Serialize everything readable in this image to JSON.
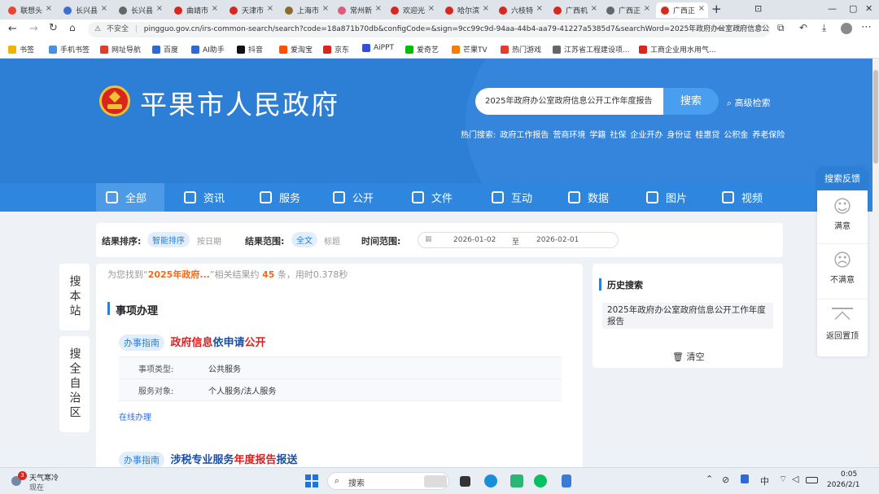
{
  "browser": {
    "tabs": [
      {
        "label": "联想头",
        "color": "#e8442e"
      },
      {
        "label": "长兴县",
        "color": "#3b6fd8"
      },
      {
        "label": "长兴县",
        "color": "#666"
      },
      {
        "label": "曲靖市",
        "color": "#d8281e"
      },
      {
        "label": "天津市",
        "color": "#d8281e"
      },
      {
        "label": "上海市",
        "color": "#8a6d2e"
      },
      {
        "label": "常州新",
        "color": "#e05a7a"
      },
      {
        "label": "欢迎光",
        "color": "#d8281e"
      },
      {
        "label": "哈尔滨",
        "color": "#d8281e"
      },
      {
        "label": "六枝特",
        "color": "#d8281e"
      },
      {
        "label": "广西机",
        "color": "#d8281e"
      },
      {
        "label": "广西正",
        "color": "#666"
      },
      {
        "label": "广西正",
        "color": "#d8281e"
      }
    ],
    "new_tab": "+",
    "insecure_label": "不安全",
    "url": "pingguo.gov.cn/irs-common-search/search?code=18a871b70db&configCode=&sign=9cc99c9d-94aa-44b4-aa79-41227a5385d7&searchWord=2025年政府办公室政府信息公...",
    "bookmarks": [
      {
        "label": "书签",
        "color": "#f0b400"
      },
      {
        "label": "手机书签",
        "color": "#4a90e2"
      },
      {
        "label": "网址导航",
        "color": "#e23c2c"
      },
      {
        "label": "百度",
        "color": "#2d6ad8"
      },
      {
        "label": "AI助手",
        "color": "#2d6ad8"
      },
      {
        "label": "抖音",
        "color": "#111"
      },
      {
        "label": "爱淘宝",
        "color": "#ff5000"
      },
      {
        "label": "京东",
        "color": "#d8281e"
      },
      {
        "label": "AiPPT",
        "color": "#3050e0"
      },
      {
        "label": "爱奇艺",
        "color": "#00be06"
      },
      {
        "label": "芒果TV",
        "color": "#ff7a00"
      },
      {
        "label": "热门游戏",
        "color": "#e23c2c"
      },
      {
        "label": "江苏省工程建设项...",
        "color": "#666"
      },
      {
        "label": "工商企业用水用气...",
        "color": "#d8281e"
      }
    ]
  },
  "site": {
    "title": "平果市人民政府",
    "search_value": "2025年政府办公室政府信息公开工作年度报告",
    "search_button": "搜索",
    "advanced": "高级检索",
    "hot_label": "热门搜索:",
    "hot": [
      "政府工作报告",
      "营商环境",
      "学籍",
      "社保",
      "企业开办",
      "身份证",
      "桂惠贷",
      "公积金",
      "养老保险"
    ],
    "nav": [
      "全部",
      "资讯",
      "服务",
      "公开",
      "文件",
      "互动",
      "数据",
      "图片",
      "视频"
    ],
    "accent": "#2d7fd6"
  },
  "filters": {
    "sort_label": "结果排序:",
    "sort_options": [
      "智能排序",
      "按日期"
    ],
    "scope_label": "结果范围:",
    "scope_options": [
      "全文",
      "标题"
    ],
    "time_label": "时间范围:",
    "date_from": "2026-01-02",
    "date_sep": "至",
    "date_to": "2026-02-01"
  },
  "side": {
    "search_site": "搜本站",
    "search_region": "搜全自治区"
  },
  "results": {
    "found_prefix": "为您找到“",
    "found_query": "2025年政府...",
    "found_mid": "”相关结果约",
    "found_count": "45",
    "found_suffix": "条，用时0.378秒",
    "section_title": "事项办理",
    "items": [
      {
        "badge": "办事指南",
        "title_parts": [
          {
            "t": "政府信息",
            "hl": true
          },
          {
            "t": "依申请",
            "hl": false
          },
          {
            "t": "公开",
            "hl": true
          }
        ],
        "rows": [
          {
            "k": "事项类型:",
            "v": "公共服务"
          },
          {
            "k": "服务对象:",
            "v": "个人服务/法人服务"
          }
        ],
        "link": "在线办理"
      },
      {
        "badge": "办事指南",
        "title_parts": [
          {
            "t": "涉税专业服务",
            "hl": false
          },
          {
            "t": "年度报告",
            "hl": true
          },
          {
            "t": "报送",
            "hl": false
          }
        ]
      }
    ]
  },
  "history": {
    "title": "历史搜索",
    "items": [
      "2025年政府办公室政府信息公开工作年度报告"
    ],
    "clear": "清空"
  },
  "feedback": {
    "title": "搜索反馈",
    "satisfied": "满意",
    "unsatisfied": "不满意",
    "back_top": "返回置顶"
  },
  "taskbar": {
    "weather_title": "天气寒冷",
    "weather_sub": "现在",
    "weather_badge": "3",
    "search": "搜索",
    "ime": "中",
    "time": "0:05",
    "date": "2026/2/1"
  }
}
